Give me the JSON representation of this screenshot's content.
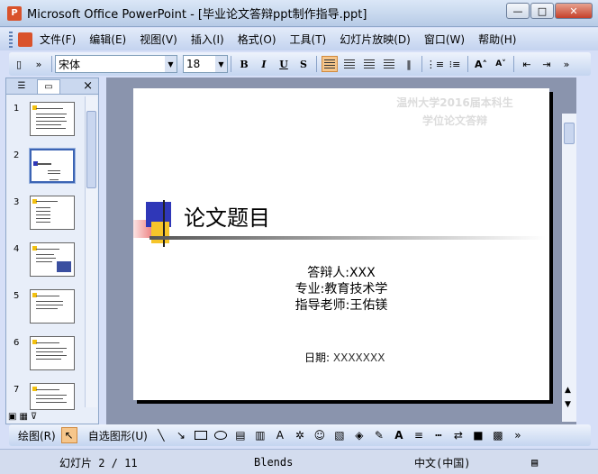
{
  "window": {
    "app_icon": "P",
    "title": "Microsoft Office PowerPoint - [毕业论文答辩ppt制作指导.ppt]",
    "minimize": "—",
    "maximize": "□",
    "close": "✕"
  },
  "menu": {
    "items": [
      "文件(F)",
      "编辑(E)",
      "视图(V)",
      "插入(I)",
      "格式(O)",
      "工具(T)",
      "幻灯片放映(D)",
      "窗口(W)",
      "帮助(H)"
    ]
  },
  "toolbar": {
    "font_name": "宋体",
    "font_size": "18",
    "bold": "B",
    "italic": "I",
    "underline": "U",
    "shadow": "S",
    "grow_font": "A",
    "shrink_font": "A"
  },
  "left_pane": {
    "slide_numbers": [
      "1",
      "2",
      "3",
      "4",
      "5",
      "6",
      "7"
    ],
    "selected_index": 2
  },
  "slide": {
    "header_line1": "温州大学2016届本科生",
    "header_line2": "学位论文答辩",
    "title": "论文题目",
    "info_lines": [
      "答辩人:XXX",
      "专业:教育技术学",
      "指导老师:王佑镁"
    ],
    "date_label": "日期:",
    "date_value": "XXXXXXX"
  },
  "drawing_toolbar": {
    "draw_label": "绘图(R)",
    "autoshapes_label": "自选图形(U)"
  },
  "status": {
    "slide_info": "幻灯片 2 / 11",
    "design": "Blends",
    "language": "中文(中国)"
  }
}
